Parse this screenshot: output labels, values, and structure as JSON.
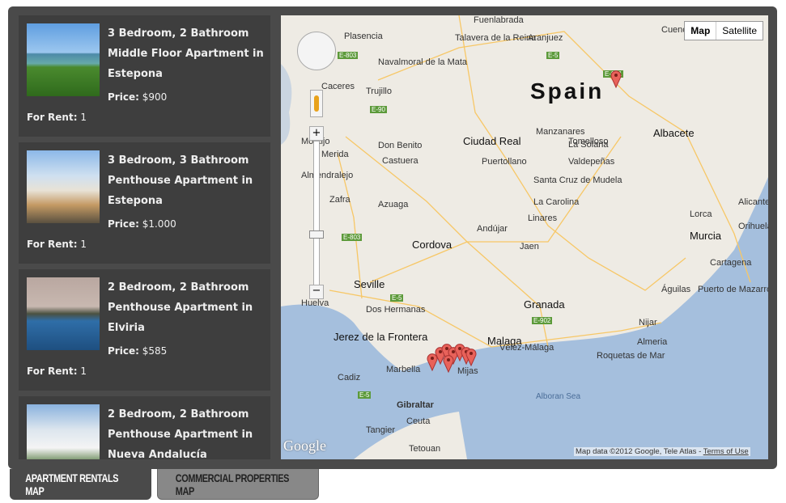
{
  "listings": [
    {
      "title": "3 Bedroom, 2 Bathroom Middle Floor Apartment in Estepona",
      "price_label": "Price:",
      "price": "$900",
      "rent_label": "For Rent:",
      "rent": "1",
      "photo": "coastline"
    },
    {
      "title": "3 Bedroom, 3 Bathroom Penthouse Apartment in Estepona",
      "price_label": "Price:",
      "price": "$1.000",
      "rent_label": "For Rent:",
      "rent": "1",
      "photo": "terrace"
    },
    {
      "title": "2 Bedroom, 2 Bathroom Penthouse Apartment in Elviria",
      "price_label": "Price:",
      "price": "$585",
      "rent_label": "For Rent:",
      "rent": "1",
      "photo": "pool-palms"
    },
    {
      "title": "2 Bedroom, 2 Bathroom Penthouse Apartment in Nueva Andalucía",
      "price_label": "Price:",
      "price": "",
      "rent_label": "",
      "rent": "",
      "photo": "white-buildings"
    }
  ],
  "map": {
    "map_button": "Map",
    "satellite_button": "Satellite",
    "country_label": "Spain",
    "sea_label": "Alboran Sea",
    "attribution": "Map data ©2012 Google, Tele Atlas -",
    "terms": "Terms of Use",
    "logo": "Google",
    "cities": [
      "Fuenlabrada",
      "Plasencia",
      "Talavera de la Reina",
      "Aranjuez",
      "Cuenca",
      "Navalmoral de la Mata",
      "Caceres",
      "Trujillo",
      "Montijo",
      "Merida",
      "Don Benito",
      "Ciudad Real",
      "Tomelloso",
      "Albacete",
      "Manzanares",
      "La Solana",
      "Almendralejo",
      "Castuera",
      "Puertollano",
      "Valdepeñas",
      "Santa Cruz de Mudela",
      "La Carolina",
      "Zafra",
      "Azuaga",
      "Linares",
      "Andújar",
      "Cordova",
      "Jaen",
      "Murcia",
      "Cartagena",
      "Seville",
      "Huelva",
      "Dos Hermanas",
      "Granada",
      "Jerez de la Frontera",
      "Cadiz",
      "Malaga",
      "Vélez-Málaga",
      "Almeria",
      "Roquetas de Mar",
      "Nijar",
      "Marbella",
      "Mijas",
      "Gibraltar",
      "Ceuta",
      "Tangier",
      "Tetouan",
      "Alicante",
      "Águilas",
      "Puerto de Mazarrón",
      "Lorca",
      "Orihuela"
    ],
    "road_labels": [
      "E-803",
      "E-5",
      "E-90",
      "E-901",
      "E-902",
      "E-5",
      "E-803",
      "E-5"
    ]
  },
  "tabs": [
    {
      "label": "APARTMENT RENTALS MAP",
      "active": true
    },
    {
      "label": "COMMERCIAL PROPERTIES MAP",
      "active": false
    }
  ],
  "colors": {
    "panel": "#4a4a4a",
    "card": "#3e3e3e",
    "active_tab": "#4a4a4a",
    "inactive_tab": "#888888",
    "sea": "#a5bfdd",
    "marker": "#e8625a"
  }
}
